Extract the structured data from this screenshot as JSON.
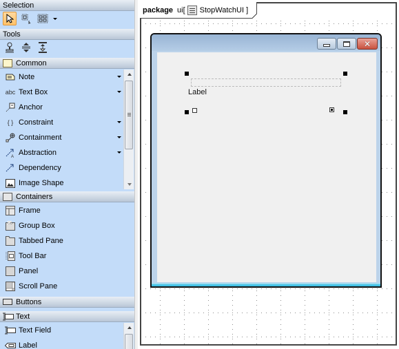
{
  "palette": {
    "selection": {
      "title": "Selection",
      "tools": [
        {
          "name": "pointer",
          "icon": "arrow-pointer-icon",
          "active": true
        },
        {
          "name": "marquee",
          "icon": "marquee-select-icon",
          "active": false
        },
        {
          "name": "multi-select",
          "icon": "multi-select-icon",
          "active": false
        }
      ]
    },
    "tools": {
      "title": "Tools",
      "items": [
        {
          "icon": "stamp-icon"
        },
        {
          "icon": "expand-vertical-icon"
        },
        {
          "icon": "align-center-icon"
        }
      ]
    },
    "common": {
      "title": "Common",
      "items": [
        {
          "label": "Note",
          "icon": "note-icon",
          "has_dropdown": true
        },
        {
          "label": "Text Box",
          "icon": "text-box-icon",
          "icon_text": "abc",
          "has_dropdown": true
        },
        {
          "label": "Anchor",
          "icon": "anchor-icon",
          "has_dropdown": false
        },
        {
          "label": "Constraint",
          "icon": "constraint-icon",
          "icon_text": "{ }",
          "has_dropdown": true
        },
        {
          "label": "Containment",
          "icon": "containment-icon",
          "has_dropdown": true
        },
        {
          "label": "Abstraction",
          "icon": "abstraction-icon",
          "has_dropdown": true
        },
        {
          "label": "Dependency",
          "icon": "dependency-icon",
          "has_dropdown": false
        },
        {
          "label": "Image Shape",
          "icon": "image-icon",
          "has_dropdown": false
        }
      ]
    },
    "containers": {
      "title": "Containers",
      "items": [
        {
          "label": "Frame",
          "icon": "frame-icon"
        },
        {
          "label": "Group Box",
          "icon": "group-box-icon"
        },
        {
          "label": "Tabbed Pane",
          "icon": "tabbed-pane-icon"
        },
        {
          "label": "Tool Bar",
          "icon": "tool-bar-icon"
        },
        {
          "label": "Panel",
          "icon": "panel-icon"
        },
        {
          "label": "Scroll Pane",
          "icon": "scroll-pane-icon"
        }
      ]
    },
    "buttons": {
      "title": "Buttons"
    },
    "text": {
      "title": "Text",
      "items": [
        {
          "label": "Text Field",
          "icon": "text-field-icon"
        },
        {
          "label": "Label",
          "icon": "label-icon"
        }
      ]
    }
  },
  "diagram": {
    "keyword": "package",
    "name_prefix": "ui[",
    "element_name": "StopWatchUI",
    "name_suffix": "]",
    "window": {
      "label_text": "Label"
    }
  }
}
